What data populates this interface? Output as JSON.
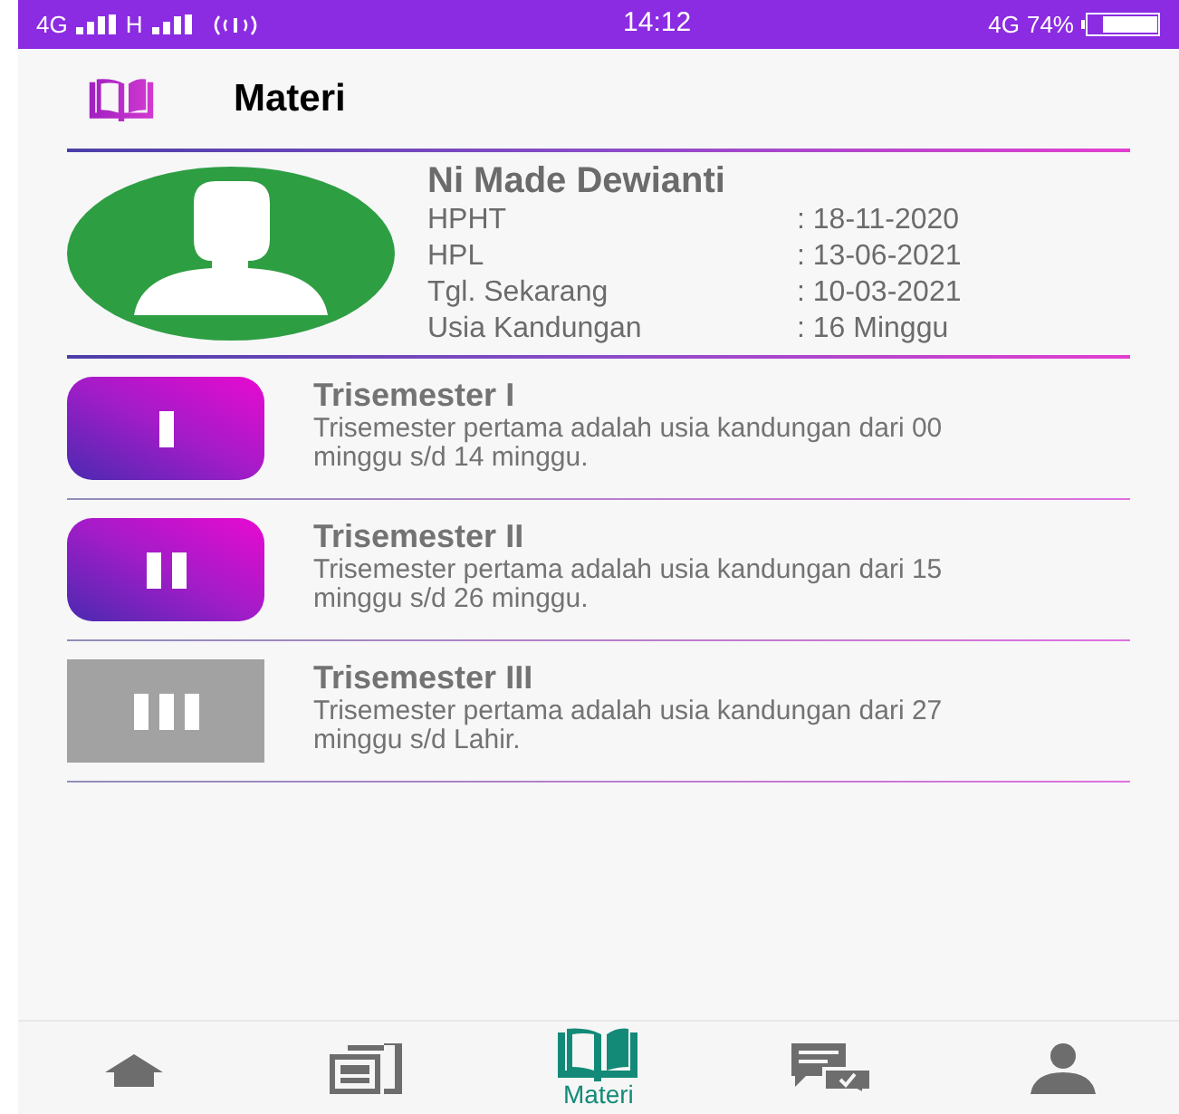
{
  "status_bar": {
    "left": "4G",
    "left_2": "H",
    "time": "14:12",
    "network": "4G",
    "battery": "74%"
  },
  "header": {
    "title": "Materi"
  },
  "profile": {
    "name": "Ni Made Dewianti",
    "fields": [
      {
        "label": "HPHT",
        "value": ": 18-11-2020"
      },
      {
        "label": "HPL",
        "value": ": 13-06-2021"
      },
      {
        "label": "Tgl. Sekarang",
        "value": ": 10-03-2021"
      },
      {
        "label": "Usia Kandungan",
        "value": ": 16 Minggu"
      }
    ]
  },
  "trimesters": [
    {
      "title": "Trisemester I",
      "description": "Trisemester pertama adalah usia kandungan dari 00 minggu s/d 14 minggu.",
      "enabled": true
    },
    {
      "title": "Trisemester II",
      "description": "Trisemester pertama adalah usia kandungan dari 15 minggu s/d 26 minggu.",
      "enabled": true
    },
    {
      "title": "Trisemester III",
      "description": "Trisemester pertama adalah usia kandungan dari 27 minggu s/d Lahir.",
      "enabled": false
    }
  ],
  "bottom_nav": [
    {
      "kind": "home",
      "selected": false
    },
    {
      "kind": "news",
      "selected": false
    },
    {
      "kind": "book",
      "label": "Materi",
      "selected": true
    },
    {
      "kind": "chat",
      "selected": false
    },
    {
      "kind": "person",
      "selected": false
    }
  ]
}
